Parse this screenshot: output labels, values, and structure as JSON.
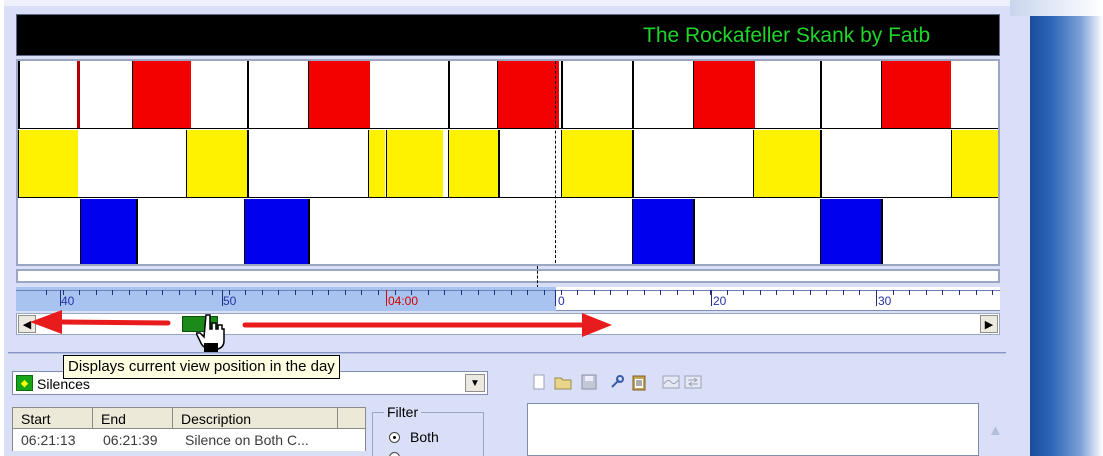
{
  "marquee": {
    "text": "The Rockafeller Skank by Fatb"
  },
  "ruler": {
    "labels": [
      {
        "text": "40",
        "red": false
      },
      {
        "text": "50",
        "red": false
      },
      {
        "text": "04:00",
        "red": true
      },
      {
        "text": "0",
        "red": false
      },
      {
        "text": "20",
        "red": false
      },
      {
        "text": "30",
        "red": false
      }
    ]
  },
  "scrollbar": {
    "left_arrow": "◀",
    "right_arrow": "▶"
  },
  "tooltip": {
    "text": "Displays current view position in the day"
  },
  "colors": {
    "red": "#f20000",
    "yellow": "#fff200",
    "blue": "#0000ee",
    "green_thumb": "#1b8a1b",
    "marquee_text": "#1fd52a"
  },
  "silences": {
    "combo_value": "Silences",
    "columns": [
      "Start",
      "End",
      "Description"
    ],
    "rows": [
      {
        "start": "06:21:13",
        "end": "06:21:39",
        "description": "Silence on Both C..."
      }
    ],
    "filter": {
      "legend": "Filter",
      "options": [
        "Both"
      ]
    }
  },
  "toolbar": {
    "icons": [
      "new-doc-icon",
      "open-folder-icon",
      "save-icon",
      "wrench-icon",
      "clipboard-icon",
      "wave-icon",
      "swap-icon"
    ]
  }
}
